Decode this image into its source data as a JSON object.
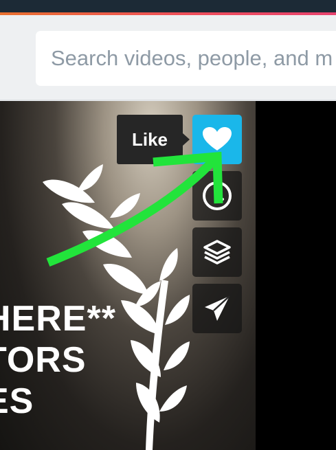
{
  "header": {
    "search": {
      "placeholder": "Search videos, people, and m",
      "icon": "search-icon"
    }
  },
  "video": {
    "title_lines": [
      "HERE**",
      "TORS",
      "ES"
    ],
    "laurel": "laurel-wreath-graphic"
  },
  "actions": {
    "like": {
      "label": "Like",
      "icon": "heart-icon",
      "color": "#1ab7ea"
    },
    "watch_later": {
      "icon": "clock-icon"
    },
    "collections": {
      "icon": "layers-icon"
    },
    "share": {
      "icon": "paper-plane-icon"
    }
  },
  "annotation": {
    "arrow_color": "#22e43b"
  }
}
